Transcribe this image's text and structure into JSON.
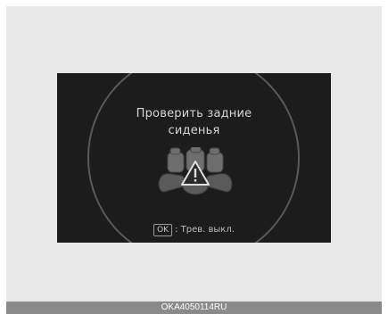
{
  "display": {
    "message_line1": "Проверить задние",
    "message_line2": "сиденья",
    "ok_key": "OK",
    "ok_action": ": Трев. выкл.",
    "icon": "rear-seats-warning-icon"
  },
  "caption": "OKA4050114RU",
  "colors": {
    "display_bg": "#1c1c1c",
    "panel_bg": "#e8e8e8",
    "caption_bg": "#8a8a8a",
    "text": "#d6d6d6"
  }
}
